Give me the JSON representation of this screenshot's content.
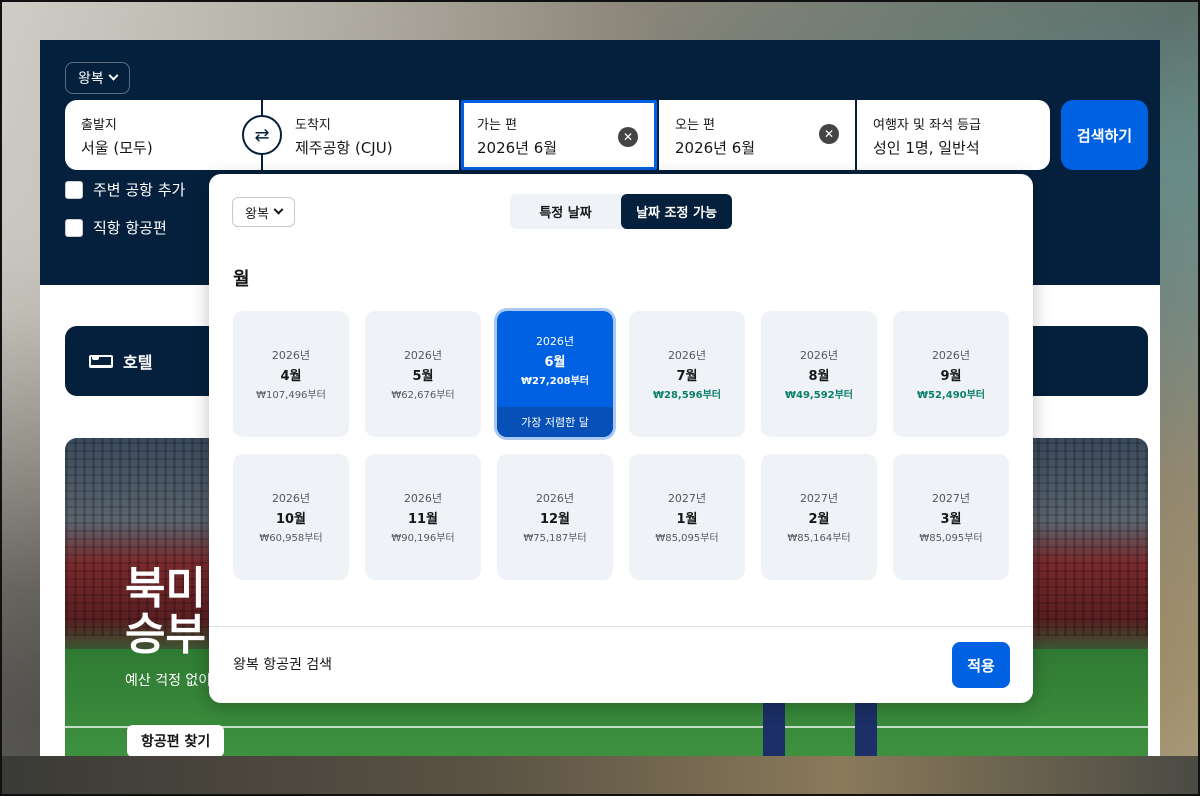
{
  "header": {
    "trip_type": "왕복",
    "search_button": "검색하기"
  },
  "fields": {
    "origin": {
      "label": "출발지",
      "value": "서울 (모두)"
    },
    "destination": {
      "label": "도착지",
      "value": "제주공항 (CJU)"
    },
    "depart": {
      "label": "가는 편",
      "value": "2026년 6월"
    },
    "return": {
      "label": "오는 편",
      "value": "2026년 6월"
    },
    "travellers": {
      "label": "여행자 및 좌석 등급",
      "value": "성인 1명, 일반석"
    }
  },
  "options": {
    "nearby_airports": "주변 공항 추가",
    "direct_flights": "직항 항공편"
  },
  "hotel_card": {
    "label": "호텔"
  },
  "promo": {
    "title_line1": "북미",
    "title_line2": "승부",
    "subtitle": "예산 걱정 없이",
    "cta": "항공편 찾기"
  },
  "datepicker": {
    "trip_type": "왕복",
    "tabs": [
      "특정 날짜",
      "날짜 조정 가능"
    ],
    "active_tab": "날짜 조정 가능",
    "heading": "월",
    "months": [
      {
        "year": "2026년",
        "month": "4월",
        "price": "₩107,496부터",
        "highlight": false,
        "selected": false
      },
      {
        "year": "2026년",
        "month": "5월",
        "price": "₩62,676부터",
        "highlight": false,
        "selected": false
      },
      {
        "year": "2026년",
        "month": "6월",
        "price": "₩27,208부터",
        "highlight": true,
        "selected": true,
        "badge": "가장 저렴한 달"
      },
      {
        "year": "2026년",
        "month": "7월",
        "price": "₩28,596부터",
        "highlight": true,
        "selected": false
      },
      {
        "year": "2026년",
        "month": "8월",
        "price": "₩49,592부터",
        "highlight": true,
        "selected": false
      },
      {
        "year": "2026년",
        "month": "9월",
        "price": "₩52,490부터",
        "highlight": true,
        "selected": false
      },
      {
        "year": "2026년",
        "month": "10월",
        "price": "₩60,958부터",
        "highlight": false,
        "selected": false
      },
      {
        "year": "2026년",
        "month": "11월",
        "price": "₩90,196부터",
        "highlight": false,
        "selected": false
      },
      {
        "year": "2026년",
        "month": "12월",
        "price": "₩75,187부터",
        "highlight": false,
        "selected": false
      },
      {
        "year": "2027년",
        "month": "1월",
        "price": "₩85,095부터",
        "highlight": false,
        "selected": false
      },
      {
        "year": "2027년",
        "month": "2월",
        "price": "₩85,164부터",
        "highlight": false,
        "selected": false
      },
      {
        "year": "2027년",
        "month": "3월",
        "price": "₩85,095부터",
        "highlight": false,
        "selected": false
      }
    ],
    "footer_text": "왕복 항공권 검색",
    "apply_button": "적용"
  },
  "colors": {
    "brand_navy": "#05203c",
    "accent_blue": "#0062e3",
    "price_green": "#0c7f6a"
  }
}
